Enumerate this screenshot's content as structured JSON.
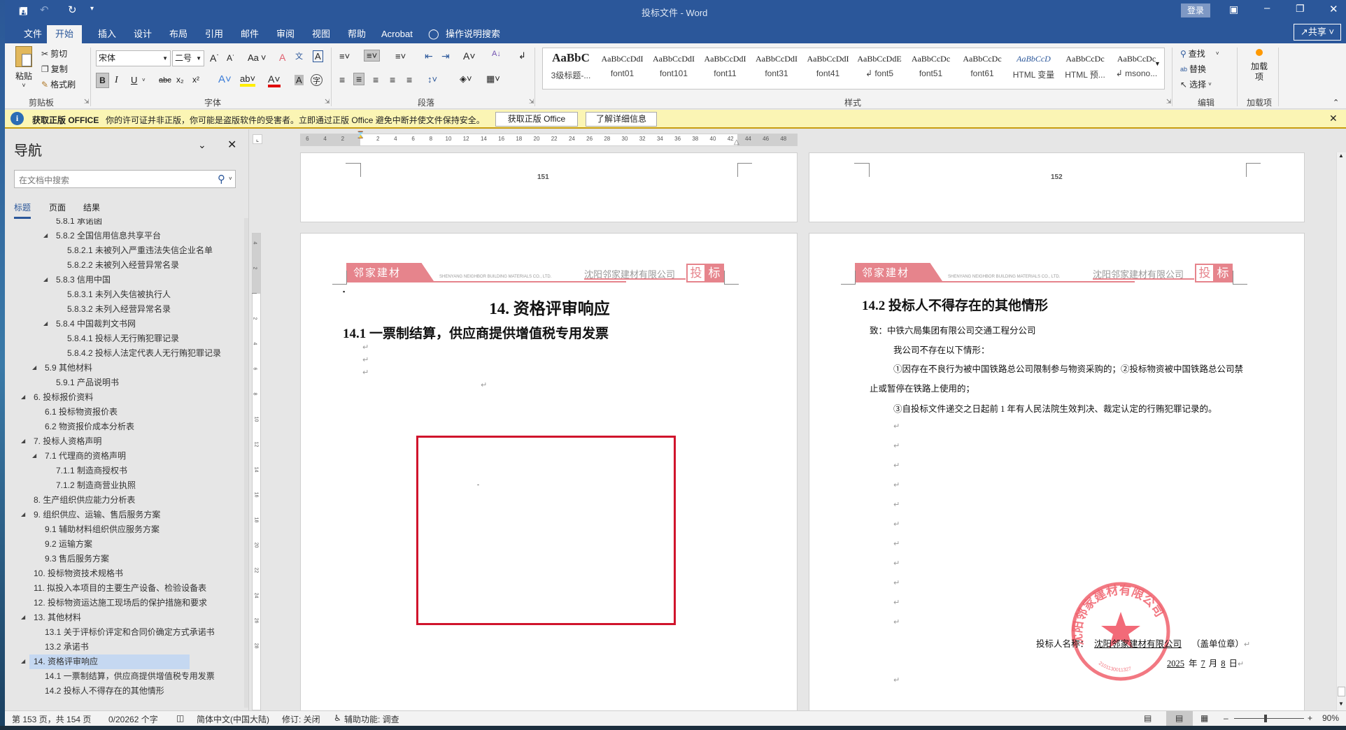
{
  "title_bar": {
    "title": "投标文件 - Word",
    "sign_in": "登录",
    "qat": [
      "save-icon",
      "undo-icon",
      "redo-icon",
      "customize-icon"
    ]
  },
  "tabs": [
    {
      "label": "文件"
    },
    {
      "label": "开始",
      "selected": true
    },
    {
      "label": "插入"
    },
    {
      "label": "设计"
    },
    {
      "label": "布局"
    },
    {
      "label": "引用"
    },
    {
      "label": "邮件"
    },
    {
      "label": "审阅"
    },
    {
      "label": "视图"
    },
    {
      "label": "帮助"
    },
    {
      "label": "Acrobat"
    },
    {
      "label": "操作说明搜索"
    }
  ],
  "share": "共享",
  "ribbon": {
    "clipboard": {
      "paste": "粘贴",
      "cut": "剪切",
      "copy": "复制",
      "format_painter": "格式刷",
      "label": "剪贴板"
    },
    "font": {
      "name": "宋体",
      "size": "二号",
      "label": "字体",
      "aa": "Aa",
      "bold": "B",
      "italic": "I",
      "underline": "U",
      "strike": "abc",
      "sub": "x₂",
      "sup": "x²"
    },
    "paragraph": {
      "label": "段落"
    },
    "styles": {
      "label": "样式",
      "items": [
        {
          "preview": "AaBbC",
          "name": "3级标题-..."
        },
        {
          "preview": "AaBbCcDdI",
          "name": "font01"
        },
        {
          "preview": "AaBbCcDdI",
          "name": "font101"
        },
        {
          "preview": "AaBbCcDdI",
          "name": "font11"
        },
        {
          "preview": "AaBbCcDdI",
          "name": "font31"
        },
        {
          "preview": "AaBbCcDdI",
          "name": "font41"
        },
        {
          "preview": "AaBbCcDdE",
          "name": "↲ font5"
        },
        {
          "preview": "AaBbCcDc",
          "name": "font51"
        },
        {
          "preview": "AaBbCcDc",
          "name": "font61"
        },
        {
          "preview": "AaBbCcD",
          "name": "HTML 变量"
        },
        {
          "preview": "AaBbCcDc",
          "name": "HTML 预..."
        },
        {
          "preview": "AaBbCcDc",
          "name": "↲ msono..."
        }
      ]
    },
    "editing": {
      "find": "查找",
      "replace": "替换",
      "select": "选择",
      "label": "编辑"
    },
    "addins": {
      "button": "加载项",
      "label": "加载项"
    }
  },
  "message_bar": {
    "title": "获取正版 OFFICE",
    "text": "你的许可证并非正版，你可能是盗版软件的受害者。立即通过正版 Office 避免中断并使文件保持安全。",
    "btn1": "获取正版 Office",
    "btn2": "了解详细信息"
  },
  "nav": {
    "title": "导航",
    "search_placeholder": "在文档中搜索",
    "tabs": [
      "标题",
      "页面",
      "结果"
    ],
    "items": [
      {
        "t": "5.8.1 承诺函",
        "l": 3
      },
      {
        "t": "5.8.2 全国信用信息共享平台",
        "l": 3,
        "e": true
      },
      {
        "t": "5.8.2.1 未被列入严重违法失信企业名单",
        "l": 4
      },
      {
        "t": "5.8.2.2 未被列入经营异常名录",
        "l": 4
      },
      {
        "t": "5.8.3 信用中国",
        "l": 3,
        "e": true
      },
      {
        "t": "5.8.3.1 未列入失信被执行人",
        "l": 4
      },
      {
        "t": "5.8.3.2 未列入经营异常名录",
        "l": 4
      },
      {
        "t": "5.8.4 中国裁判文书网",
        "l": 3,
        "e": true
      },
      {
        "t": "5.8.4.1 投标人无行贿犯罪记录",
        "l": 4
      },
      {
        "t": "5.8.4.2 投标人法定代表人无行贿犯罪记录",
        "l": 4
      },
      {
        "t": "5.9 其他材料",
        "l": 2,
        "e": true
      },
      {
        "t": "5.9.1 产品说明书",
        "l": 3
      },
      {
        "t": "6. 投标报价资料",
        "l": 1,
        "e": true
      },
      {
        "t": "6.1 投标物资报价表",
        "l": 2
      },
      {
        "t": "6.2 物资报价成本分析表",
        "l": 2
      },
      {
        "t": "7. 投标人资格声明",
        "l": 1,
        "e": true
      },
      {
        "t": "7.1 代理商的资格声明",
        "l": 2,
        "e": true
      },
      {
        "t": "7.1.1 制造商授权书",
        "l": 3
      },
      {
        "t": "7.1.2 制造商营业执照",
        "l": 3
      },
      {
        "t": "8. 生产组织供应能力分析表",
        "l": 1
      },
      {
        "t": "9. 组织供应、运输、售后服务方案",
        "l": 1,
        "e": true
      },
      {
        "t": "9.1 辅助材料组织供应服务方案",
        "l": 2
      },
      {
        "t": "9.2 运输方案",
        "l": 2
      },
      {
        "t": "9.3 售后服务方案",
        "l": 2
      },
      {
        "t": "10. 投标物资技术规格书",
        "l": 1
      },
      {
        "t": "11. 拟投入本项目的主要生产设备、检验设备表",
        "l": 1
      },
      {
        "t": "12. 投标物资运达施工现场后的保护措施和要求",
        "l": 1
      },
      {
        "t": "13. 其他材料",
        "l": 1,
        "e": true
      },
      {
        "t": "13.1 关于评标价评定和合同价确定方式承诺书",
        "l": 2
      },
      {
        "t": "13.2 承诺书",
        "l": 2
      },
      {
        "t": "14. 资格评审响应",
        "l": 1,
        "e": true,
        "sel": true
      },
      {
        "t": "14.1 一票制结算，供应商提供增值税专用发票",
        "l": 2
      },
      {
        "t": "14.2 投标人不得存在的其他情形",
        "l": 2
      }
    ]
  },
  "ruler": {
    "left": [
      "6",
      "4",
      "2"
    ],
    "main": [
      "2",
      "4",
      "6",
      "8",
      "10",
      "12",
      "14",
      "16",
      "18",
      "20",
      "22",
      "24",
      "26",
      "28",
      "30",
      "32",
      "34",
      "36",
      "38",
      "40",
      "42"
    ],
    "right": [
      "44",
      "46",
      "48"
    ],
    "vertical": [
      "4",
      "2",
      "",
      "2",
      "4",
      "6",
      "8",
      "10",
      "12",
      "14",
      "16",
      "18",
      "20",
      "22",
      "24",
      "26",
      "28"
    ]
  },
  "doc": {
    "left_prev_page_number": "151",
    "right_prev_page_number": "152",
    "banner": {
      "brand": "邻家建材",
      "english": "SHENYANG NEIGHBOR BUILDING MATERIALS CO., LTD.",
      "company": "沈阳邻家建材有限公司",
      "tag1": "投",
      "tag2": "标"
    },
    "left": {
      "h1": "14.  资格评审响应",
      "h2": "14.1 一票制结算，供应商提供增值税专用发票",
      "box_color": "#d0142c"
    },
    "right": {
      "h2": "14.2 投标人不得存在的其他情形",
      "p1": "致：中铁六局集团有限公司交通工程分公司",
      "p2": "我公司不存在以下情形：",
      "p3": "①因存在不良行为被中国铁路总公司限制参与物资采购的；②投标物资被中国铁路总公司禁",
      "p4": "止或暂停在铁路上使用的；",
      "p5": "③自投标文件递交之日起前 1 年有人民法院生效判决、裁定认定的行贿犯罪记录的。",
      "sig_label": "投标人名称：",
      "sig_name": "沈阳邻家建材有限公司",
      "sig_suffix": "（盖单位章）",
      "year": "2025",
      "y": "年",
      "month": "7",
      "m": "月",
      "day": "8",
      "d": "日",
      "stamp": {
        "text": "沈阳邻家建材有限公司",
        "number": "2101130011327"
      }
    }
  },
  "status": {
    "page": "第 153 页，共 154 页",
    "words": "0/20262 个字",
    "language": "简体中文(中国大陆)",
    "track": "修订: 关闭",
    "accessibility": "辅助功能: 调查",
    "zoom": "90%",
    "zoom_value": 90
  }
}
